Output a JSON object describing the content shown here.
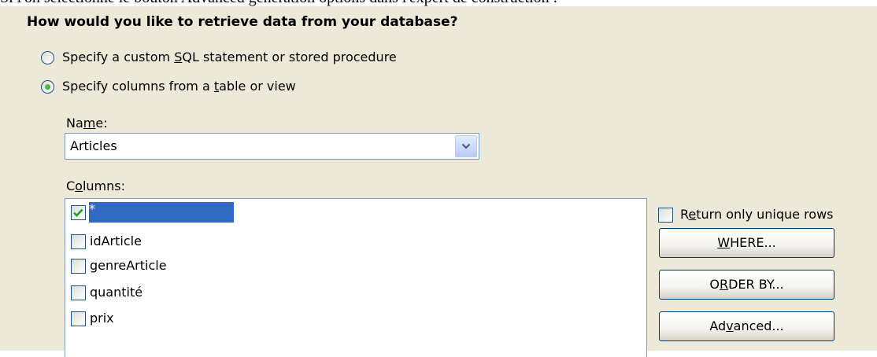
{
  "caption": "Si l'on sélectionne le bouton Advanced génération options dans l'expert de construction :",
  "heading": "How would you like to retrieve data from your database?",
  "options": {
    "custom_sql": {
      "pre": "Specify a custom ",
      "key": "S",
      "post": "QL statement or stored procedure",
      "checked": false
    },
    "columns_from_table": {
      "pre": "Specify columns from a ",
      "key": "t",
      "post": "able or view",
      "checked": true
    }
  },
  "name_field": {
    "label_pre": "Na",
    "label_key": "m",
    "label_post": "e:",
    "value": "Articles"
  },
  "columns_field": {
    "label_pre": "C",
    "label_key": "o",
    "label_post": "lumns:"
  },
  "columns": [
    {
      "label": "*",
      "checked": true,
      "selected": true
    },
    {
      "label": "idArticle",
      "checked": false,
      "selected": false
    },
    {
      "label": "genreArticle",
      "checked": false,
      "selected": false
    },
    {
      "label": "quantité",
      "checked": false,
      "selected": false
    },
    {
      "label": "prix",
      "checked": false,
      "selected": false
    }
  ],
  "unique_rows": {
    "pre": "R",
    "key": "e",
    "post": "turn only unique rows",
    "checked": false
  },
  "buttons": {
    "where": {
      "key": "W",
      "post": "HERE..."
    },
    "order_by": {
      "pre": "O",
      "key": "R",
      "post": "DER BY..."
    },
    "advanced": {
      "pre": "Ad",
      "key": "v",
      "post": "anced..."
    }
  },
  "icons": {
    "dropdown": "chevron-down-icon",
    "check": "checkmark-icon"
  },
  "colors": {
    "panel": "#ece9d8",
    "selection": "#316ac5",
    "border": "#7f9db9",
    "check": "#21a121"
  }
}
